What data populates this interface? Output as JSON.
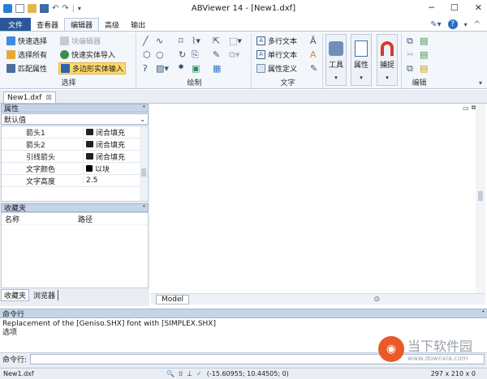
{
  "window": {
    "title": "ABViewer 14 - [New1.dxf]"
  },
  "quick_access": {
    "sep": "|"
  },
  "tabs": [
    "文件",
    "查看器",
    "编辑器",
    "高级",
    "输出"
  ],
  "ribbon": {
    "select": {
      "label": "选择",
      "items": [
        "快速选择",
        "选择所有",
        "匹配属性",
        "块编辑器",
        "快速实体导入",
        "多边形实体输入"
      ]
    },
    "draw": {
      "label": "绘制"
    },
    "text": {
      "label": "文字",
      "items": [
        "多行文本",
        "单行文本",
        "属性定义"
      ]
    },
    "tools": {
      "label": "工具"
    },
    "props": {
      "label": "属性"
    },
    "snap": {
      "label": "捕捉"
    },
    "edit": {
      "label": "编辑"
    }
  },
  "doc_tab": {
    "name": "New1.dxf",
    "close": "⊠"
  },
  "properties": {
    "title": "属性",
    "pin": "ᐩ",
    "filter": "默认值",
    "rows": [
      {
        "k": "箭头1",
        "v": "闭合填充"
      },
      {
        "k": "箭头2",
        "v": "闭合填充"
      },
      {
        "k": "引线箭头",
        "v": "闭合填充"
      },
      {
        "k": "文字颜色",
        "v": "以块"
      },
      {
        "k": "文字高度",
        "v": "2.5"
      }
    ]
  },
  "favorites": {
    "title": "收藏夹",
    "cols": [
      "名称",
      "路径"
    ]
  },
  "left_tabs": [
    "收藏夹",
    "浏览器"
  ],
  "layout": {
    "tab": "Model"
  },
  "command": {
    "title": "命令行",
    "lines": [
      "Replacement of the [Geniso.SHX] font with [SIMPLEX.SHX]",
      "选项"
    ],
    "label": "命令行:",
    "input": ""
  },
  "status": {
    "file": "New1.dxf",
    "coords": "(-15.60955; 10.44505; 0)",
    "size": "297 x 210 x 0"
  },
  "watermark": {
    "title": "当下软件园",
    "url": "www.downxia.com"
  },
  "colors": {
    "file_tab": "#2b5797",
    "ribbon": "#f3f6fa",
    "panel": "#eaeef4",
    "highlight": "#ffd96b"
  }
}
